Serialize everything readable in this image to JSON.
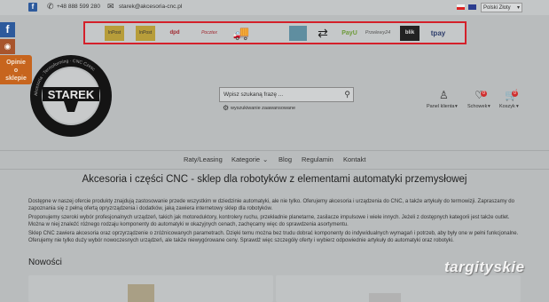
{
  "topbar": {
    "facebook_glyph": "f",
    "phone_icon": "phone-icon",
    "phone": "+48 888 599 280",
    "email_icon": "mail-icon",
    "email": "starek@akcesoria-cnc.pl",
    "currency": "Polski Złoty"
  },
  "payments": [
    "InPost",
    "InPost",
    "dpd",
    "Pocztex",
    "truck",
    "box",
    "swap",
    "PayU",
    "Przelewy24",
    "blik",
    "tpay"
  ],
  "sidebar": {
    "facebook_glyph": "f",
    "opinie": [
      "Opinie",
      "o",
      "sklepie"
    ]
  },
  "logo": {
    "text": "STAREK",
    "ring_text": "Akcesoria · Termoforming · CNC Czesc"
  },
  "search": {
    "placeholder": "Wpisz szukaną frazę ...",
    "advanced": "wyszukiwanie zaawansowane"
  },
  "header_icons": {
    "account_label": "Panel klienta",
    "wishlist_label": "Schowek",
    "wishlist_count": "0",
    "cart_label": "Koszyk",
    "cart_count": "0"
  },
  "nav": [
    "Raty/Leasing",
    "Kategorie",
    "Blog",
    "Regulamin",
    "Kontakt"
  ],
  "main": {
    "title": "Akcesoria i części CNC - sklep dla robotyków z elementami automatyki przemysłowej",
    "p1": "Dostępne w naszej ofercie produkty znajdują zastosowanie przede wszystkim w dziedzinie automatyki, ale nie tylko. Oferujemy akcesoria i urządzenia do CNC, a także artykuły do termowizji. Zapraszamy do zapoznania się z pełną ofertą opryzrządzenia i dodatków, jaką zawiera internetowy sklep dla robotyków.",
    "p2": "Proponujemy szeroki wybór profesjonalnych urządzeń, takich jak motoreduktory, kontrolery ruchu, przekładnie planetarne, zasilacze impulsowe i wiele innych. Jeżeli z dostępnych kategorii jest także outlet. Można w niej znaleźć różnego rodzaju komponenty do automatyki w okazyjnych cenach, zachęcamy więc do sprawdzenia asortymentu.",
    "p3": "Sklep CNC zawiera akcesoria oraz oprzyrządzenie o zróżnicowanych parametrach. Dzięki temu można bez trudu dobrać komponenty do indywidualnych wymagań i potrzeb, aby były one w pełni funkcjonalne. Oferujemy nie tylko duży wybór nowoczesnych urządzeń, ale także niewygórowane ceny. Sprawdź więc szczegóły oferty i wybierz odpowiednie artykuły do automatyki oraz robotyki.",
    "section_title": "Nowości"
  },
  "watermark": "targityskie",
  "colors": {
    "accent_red": "#d4202a",
    "opinie_orange": "#c7651e",
    "facebook_blue": "#2d5a9c"
  }
}
